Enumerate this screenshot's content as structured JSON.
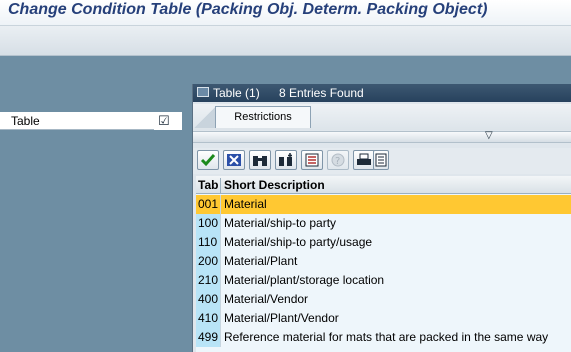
{
  "window": {
    "title": "Change Condition Table (Packing Obj. Determ. Packing Object)"
  },
  "selection": {
    "field_label": "Table",
    "checkbox_glyph": "☑"
  },
  "dialog": {
    "title": "Table (1)",
    "entries_found": "8 Entries Found",
    "tab_restrictions": "Restrictions",
    "collapse_glyph": "▽",
    "buttons": [
      {
        "name": "continue-button",
        "icon": "green-check-icon"
      },
      {
        "name": "cancel-button",
        "icon": "blue-x-icon"
      },
      {
        "name": "find-button",
        "icon": "binoculars-icon"
      },
      {
        "name": "find-next-button",
        "icon": "binoculars-plus-icon"
      },
      {
        "name": "sort-button",
        "icon": "sort-icon"
      },
      {
        "name": "help-button",
        "icon": "help-icon",
        "disabled": true
      },
      {
        "name": "print-button",
        "icon": "printer-icon"
      },
      {
        "name": "list-button",
        "icon": "list-icon"
      }
    ],
    "table": {
      "columns": [
        "Tab",
        "Short Description"
      ],
      "rows": [
        {
          "tab": "001",
          "desc": "Material",
          "selected": true
        },
        {
          "tab": "100",
          "desc": "Material/ship-to party"
        },
        {
          "tab": "110",
          "desc": "Material/ship-to party/usage"
        },
        {
          "tab": "200",
          "desc": "Material/Plant"
        },
        {
          "tab": "210",
          "desc": "Material/plant/storage location"
        },
        {
          "tab": "400",
          "desc": "Material/Vendor"
        },
        {
          "tab": "410",
          "desc": "Material/Plant/Vendor"
        },
        {
          "tab": "499",
          "desc": "Reference material for mats that are packed in the same way"
        }
      ]
    }
  },
  "colors": {
    "background": "#6e8ea3",
    "selected_row": "#ffc832",
    "key_column": "#b8e4f7",
    "dialog_header": "#27425d",
    "title_text": "#26407a"
  }
}
